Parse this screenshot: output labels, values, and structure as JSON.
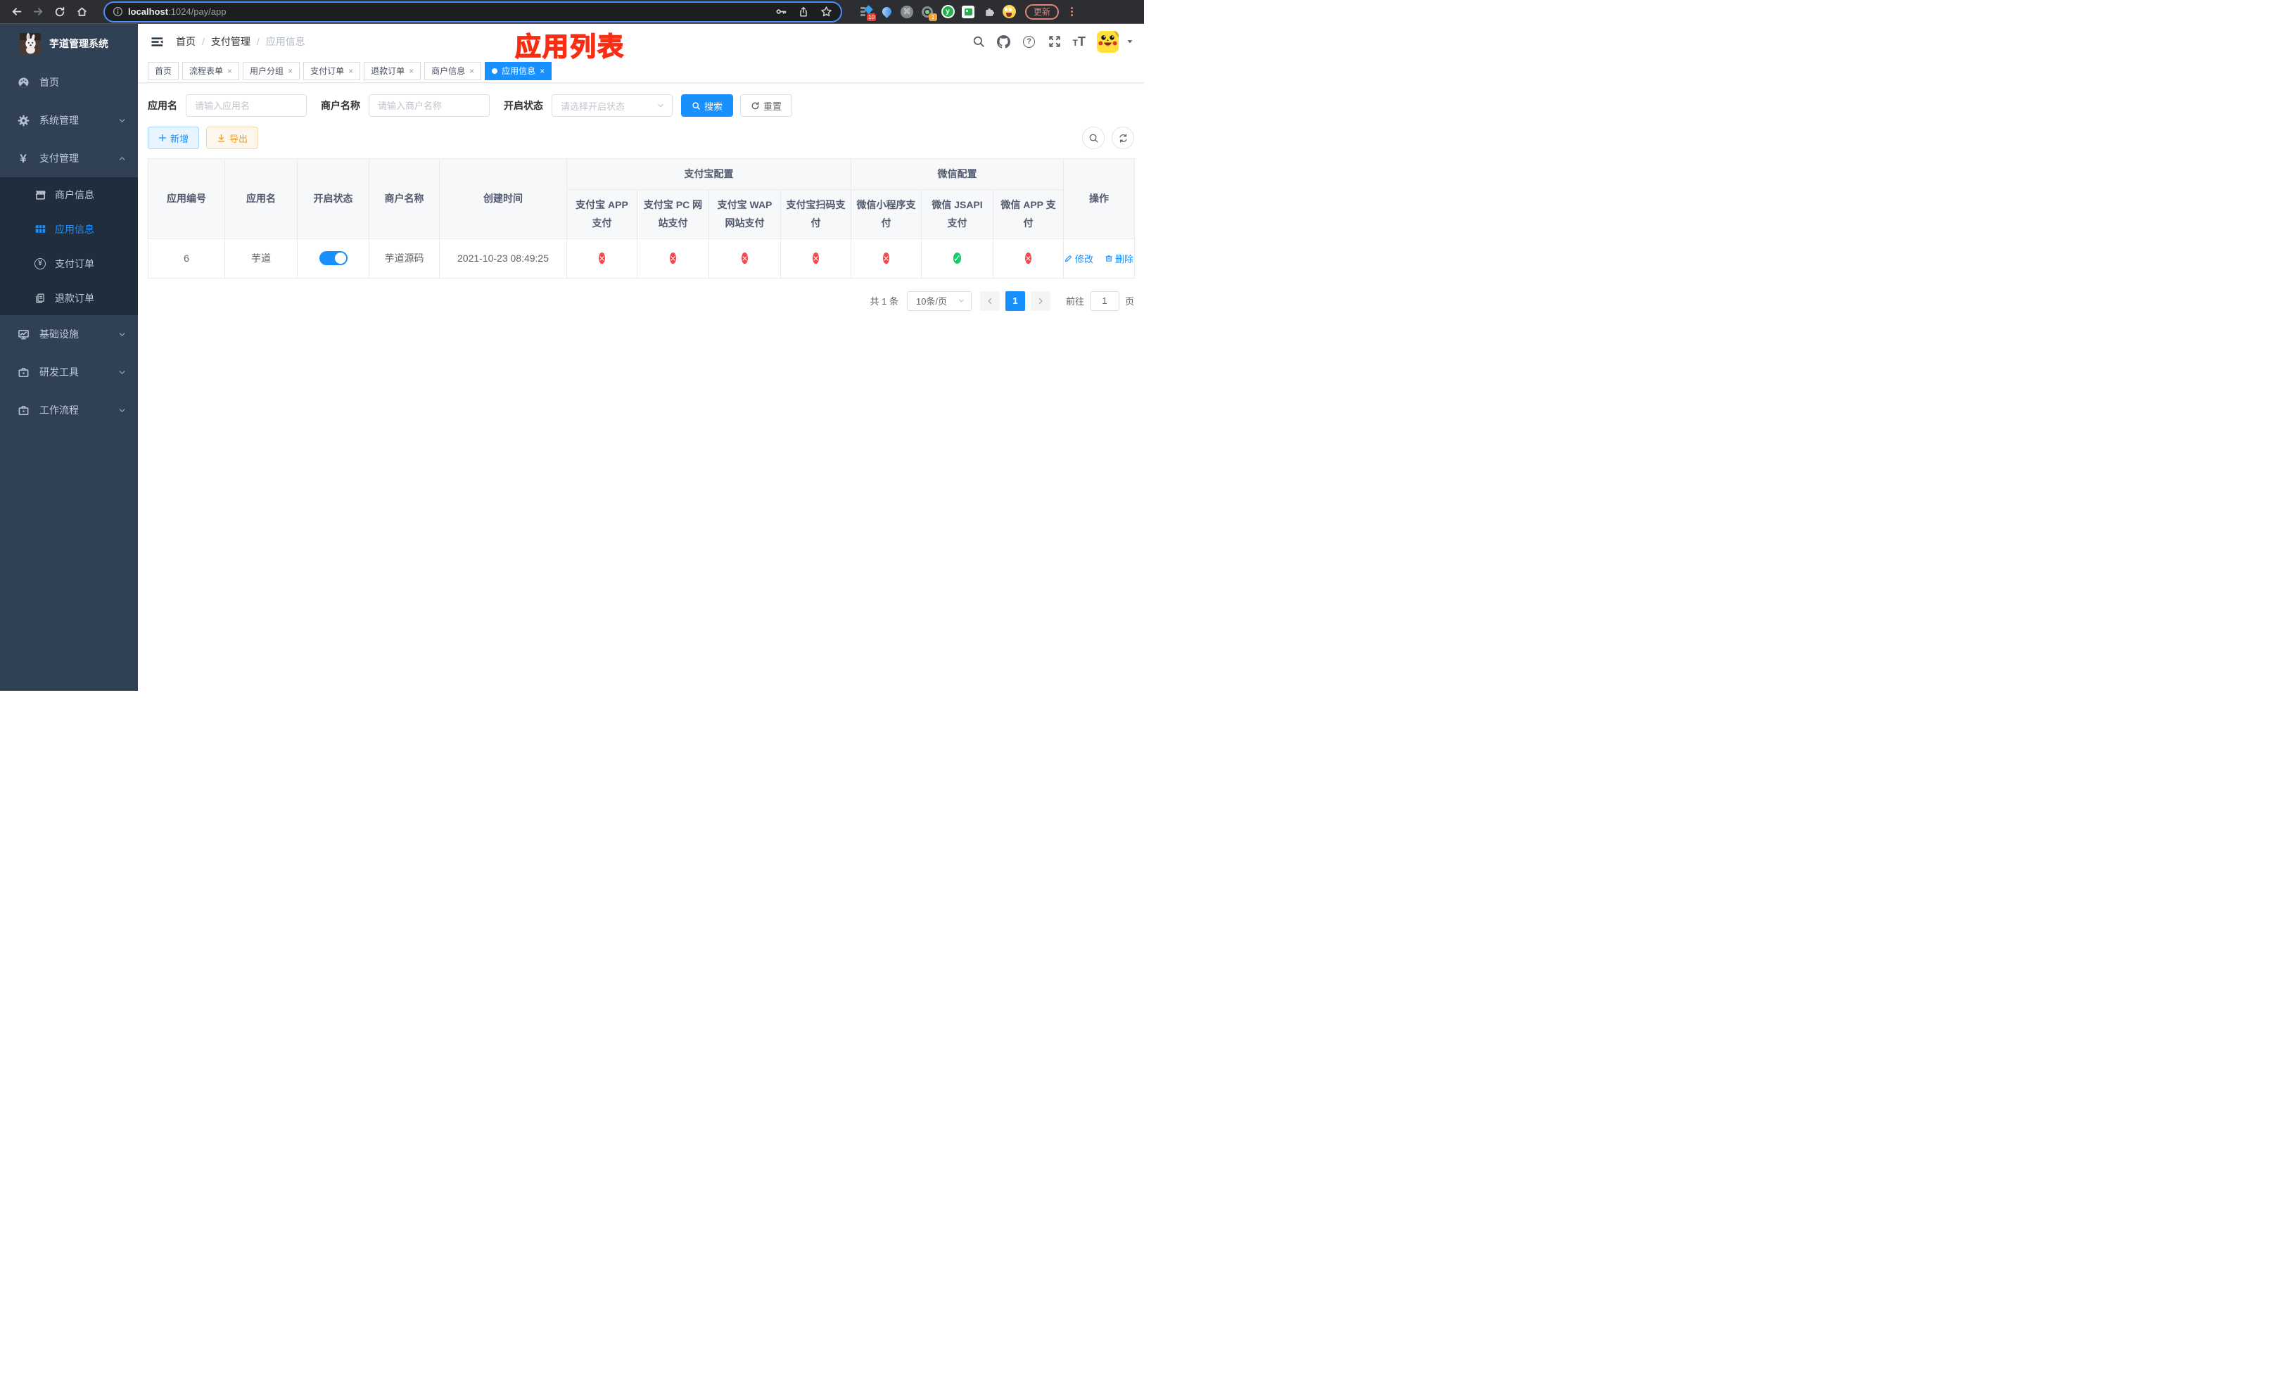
{
  "browser": {
    "url_host": "localhost",
    "url_path": ":1024/pay/app",
    "update_label": "更新",
    "ext_badges": {
      "sidebar": "10",
      "profile": "1"
    }
  },
  "sidebar": {
    "title": "芋道管理系统",
    "menu": [
      {
        "label": "首页"
      },
      {
        "label": "系统管理"
      },
      {
        "label": "支付管理"
      },
      {
        "label": "商户信息"
      },
      {
        "label": "应用信息"
      },
      {
        "label": "支付订单"
      },
      {
        "label": "退款订单"
      },
      {
        "label": "基础设施"
      },
      {
        "label": "研发工具"
      },
      {
        "label": "工作流程"
      }
    ]
  },
  "navbar": {
    "breadcrumb": {
      "home": "首页",
      "section": "支付管理",
      "current": "应用信息"
    },
    "annotation": "应用列表"
  },
  "tags": [
    {
      "label": "首页"
    },
    {
      "label": "流程表单"
    },
    {
      "label": "用户分组"
    },
    {
      "label": "支付订单"
    },
    {
      "label": "退款订单"
    },
    {
      "label": "商户信息"
    },
    {
      "label": "应用信息"
    }
  ],
  "filters": {
    "app_name_label": "应用名",
    "app_name_placeholder": "请输入应用名",
    "merchant_label": "商户名称",
    "merchant_placeholder": "请输入商户名称",
    "status_label": "开启状态",
    "status_placeholder": "请选择开启状态",
    "search_button": "搜索",
    "reset_button": "重置"
  },
  "toolbar": {
    "add_button": "新增",
    "export_button": "导出"
  },
  "table": {
    "headers": {
      "app_id": "应用编号",
      "app_name": "应用名",
      "status": "开启状态",
      "merchant": "商户名称",
      "created": "创建时间",
      "alipay_group": "支付宝配置",
      "wechat_group": "微信配置",
      "alipay_app": "支付宝 APP 支付",
      "alipay_pc": "支付宝 PC 网站支付",
      "alipay_wap": "支付宝 WAP 网站支付",
      "alipay_qr": "支付宝扫码支付",
      "wx_mini": "微信小程序支付",
      "wx_jsapi": "微信 JSAPI 支付",
      "wx_app": "微信 APP 支付",
      "actions": "操作"
    },
    "row": {
      "app_id": "6",
      "app_name": "芋道",
      "status_on": true,
      "merchant": "芋道源码",
      "created": "2021-10-23 08:49:25",
      "channels": [
        "disabled",
        "disabled",
        "disabled",
        "disabled",
        "disabled",
        "enabled",
        "disabled"
      ],
      "edit": "修改",
      "delete": "删除"
    }
  },
  "pagination": {
    "total": "共 1 条",
    "page_size": "10条/页",
    "current_page": "1",
    "goto_label": "前往",
    "goto_value": "1",
    "goto_suffix": "页"
  },
  "glyphs": {
    "yen": "¥",
    "cross": "×",
    "check": "✓",
    "question": "?",
    "command": "⌘",
    "slash": "/",
    "close": "×",
    "letter_t": "T",
    "letter_y": "y"
  }
}
